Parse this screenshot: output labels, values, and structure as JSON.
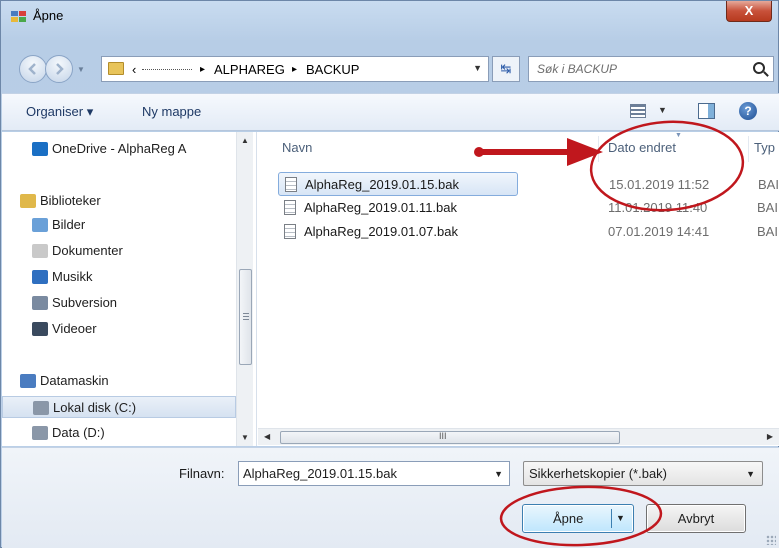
{
  "window": {
    "title": "Åpne",
    "close_label": "X"
  },
  "nav": {
    "breadcrumbs": [
      "‹",
      "ALPHAREG",
      "BACKUP"
    ],
    "separator": "▸",
    "search_placeholder": "Søk i BACKUP",
    "refresh_glyph": "↹"
  },
  "toolbar": {
    "organize_label": "Organiser ▾",
    "new_folder_label": "Ny mappe",
    "help_glyph": "?"
  },
  "sidebar": {
    "items": [
      {
        "label": "OneDrive - AlphaReg A",
        "icon": "onedrive-icon",
        "color": "#1a6fc4"
      },
      {
        "label": "Biblioteker",
        "icon": "library-icon",
        "color": "#e0b84a"
      },
      {
        "label": "Bilder",
        "icon": "pictures-icon",
        "color": "#6aa0d8"
      },
      {
        "label": "Dokumenter",
        "icon": "documents-icon",
        "color": "#c9c9c9"
      },
      {
        "label": "Musikk",
        "icon": "music-icon",
        "color": "#2f6fc0"
      },
      {
        "label": "Subversion",
        "icon": "subversion-icon",
        "color": "#7a8aa0"
      },
      {
        "label": "Videoer",
        "icon": "videos-icon",
        "color": "#3a4a5e"
      },
      {
        "label": "Datamaskin",
        "icon": "computer-icon",
        "color": "#4a7cc0"
      },
      {
        "label": "Lokal disk (C:)",
        "icon": "drive-c-icon",
        "color": "#8a97a8"
      },
      {
        "label": "Data (D:)",
        "icon": "drive-d-icon",
        "color": "#8a97a8"
      }
    ]
  },
  "columns": {
    "name": "Navn",
    "date": "Dato endret",
    "type": "Typ"
  },
  "files": [
    {
      "name": "AlphaReg_2019.01.15.bak",
      "date": "15.01.2019 11:52",
      "type": "BAI"
    },
    {
      "name": "AlphaReg_2019.01.11.bak",
      "date": "11.01.2019 11:40",
      "type": "BAI"
    },
    {
      "name": "AlphaReg_2019.01.07.bak",
      "date": "07.01.2019 14:41",
      "type": "BAI"
    }
  ],
  "hscroll_label": "III",
  "bottom": {
    "filename_label": "Filnavn:",
    "filename_value": "AlphaReg_2019.01.15.bak",
    "filetype_value": "Sikkerhetskopier  (*.bak)",
    "open_label": "Åpne",
    "cancel_label": "Avbryt"
  },
  "annotation": {
    "color": "#c0171d"
  }
}
